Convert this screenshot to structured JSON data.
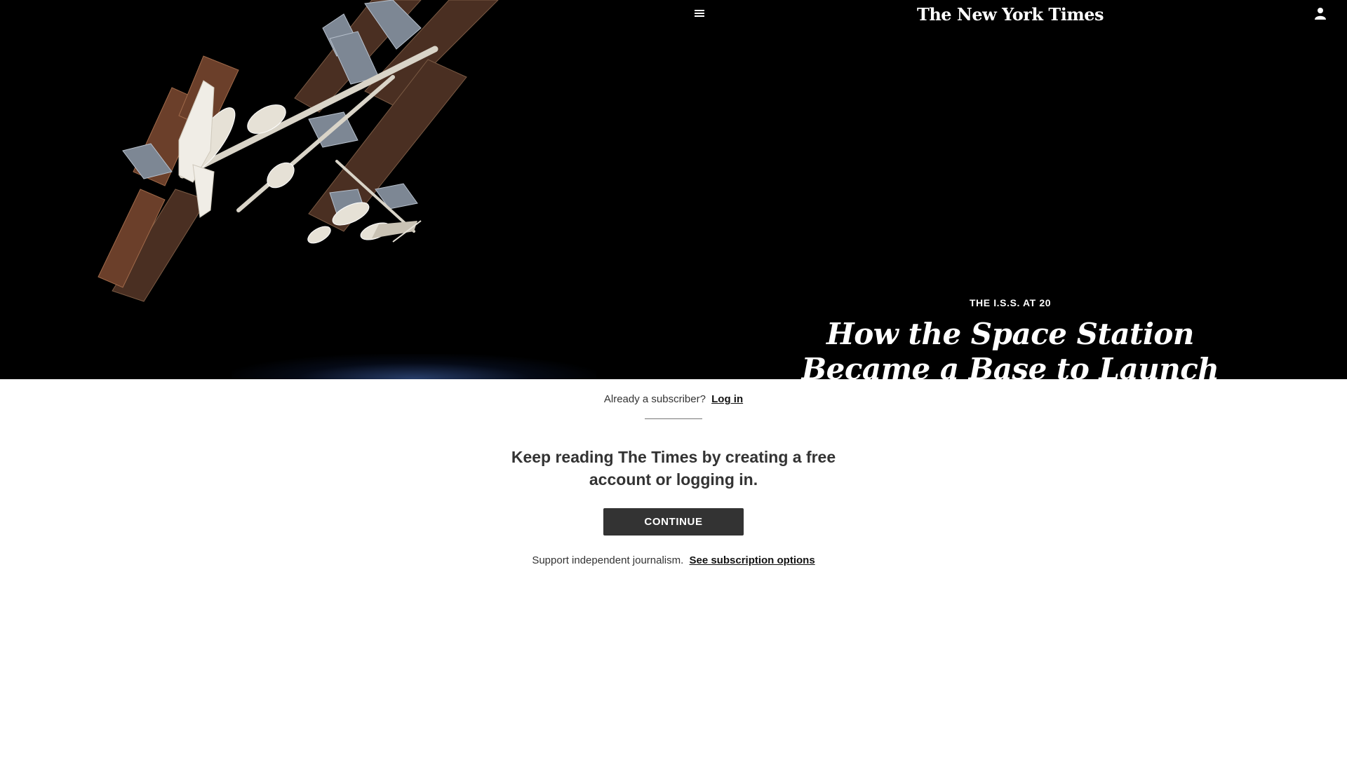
{
  "header": {
    "menu_icon": "hamburger-menu-icon",
    "logo_text": "The New York Times",
    "user_icon": "user-account-icon"
  },
  "hero": {
    "kicker": "THE I.S.S. AT 20",
    "headline": "How the Space Station Became a Base to Launch Humanity’s Future",
    "image_icon": "space-station-photo"
  },
  "paywall": {
    "subscriber_prompt": "Already a subscriber?",
    "login_link": "Log in",
    "heading": "Keep reading The Times by creating a free account or logging in.",
    "continue_label": "CONTINUE",
    "support_text": "Support independent journalism.",
    "subscription_link": "See subscription options"
  },
  "colors": {
    "hero_background": "#000000",
    "panel_background": "#ffffff",
    "button_background": "#333333",
    "text_primary": "#333333",
    "text_on_dark": "#ffffff"
  }
}
